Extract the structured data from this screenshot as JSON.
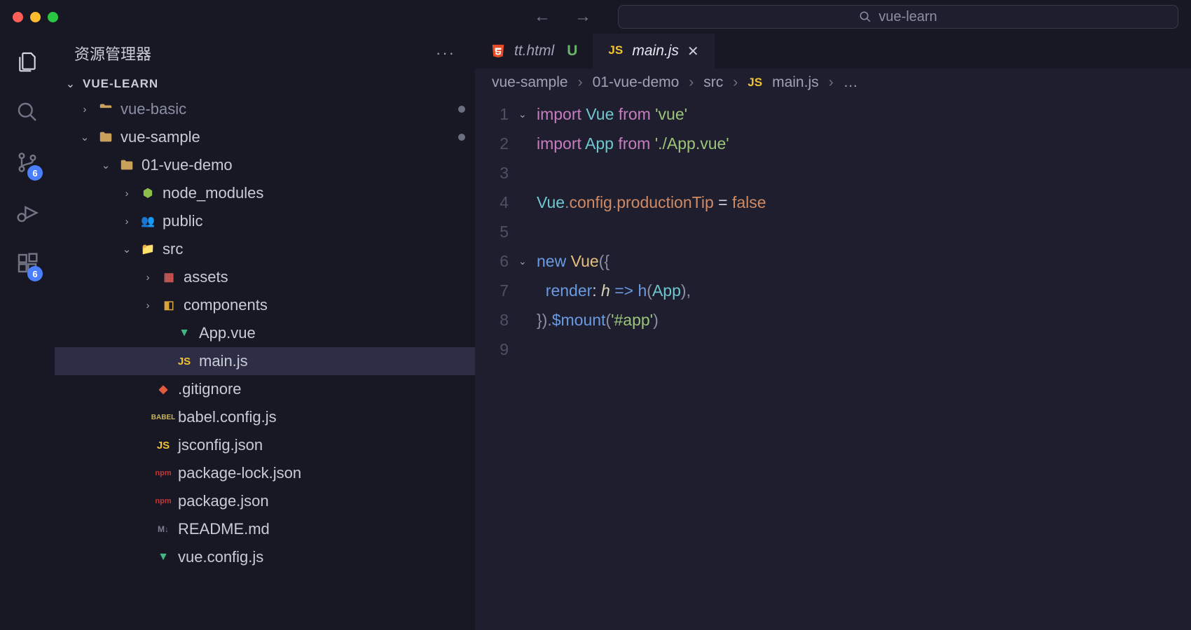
{
  "titlebar": {
    "search_text": "vue-learn"
  },
  "activitybar": {
    "source_control_badge": "6",
    "extensions_badge": "6"
  },
  "sidebar": {
    "header_title": "资源管理器",
    "root_label": "VUE-LEARN",
    "tree": {
      "vue_basic": "vue-basic",
      "vue_sample": "vue-sample",
      "vue_demo": "01-vue-demo",
      "node_modules": "node_modules",
      "public": "public",
      "src": "src",
      "assets": "assets",
      "components": "components",
      "app_vue": "App.vue",
      "main_js": "main.js",
      "gitignore": ".gitignore",
      "babel": "babel.config.js",
      "jsconfig": "jsconfig.json",
      "pkg_lock": "package-lock.json",
      "pkg": "package.json",
      "readme": "README.md",
      "vueconfig": "vue.config.js"
    }
  },
  "tabs": {
    "tt_html": "tt.html",
    "tt_status": "U",
    "main_js": "main.js"
  },
  "breadcrumbs": {
    "p1": "vue-sample",
    "p2": "01-vue-demo",
    "p3": "src",
    "p4": "main.js",
    "ellipsis": "…"
  },
  "code": {
    "lines": [
      "1",
      "2",
      "3",
      "4",
      "5",
      "6",
      "7",
      "8",
      "9"
    ],
    "l1": {
      "a": "import",
      "b": " Vue ",
      "c": "from",
      "d": " 'vue'"
    },
    "l2": {
      "a": "import",
      "b": " App ",
      "c": "from",
      "d": " './App.vue'"
    },
    "l4": {
      "a": "Vue",
      "b": ".",
      "c": "config",
      "d": ".",
      "e": "productionTip",
      "f": " = ",
      "g": "false"
    },
    "l6": {
      "a": "new",
      "b": " ",
      "c": "Vue",
      "d": "({"
    },
    "l7": {
      "a": "  ",
      "b": "render",
      "c": ": ",
      "d": "h",
      "e": " => ",
      "f": "h",
      "g": "(",
      "h": "App",
      "i": "),"
    },
    "l8": {
      "a": "}).",
      "b": "$mount",
      "c": "(",
      "d": "'#app'",
      "e": ")"
    }
  }
}
